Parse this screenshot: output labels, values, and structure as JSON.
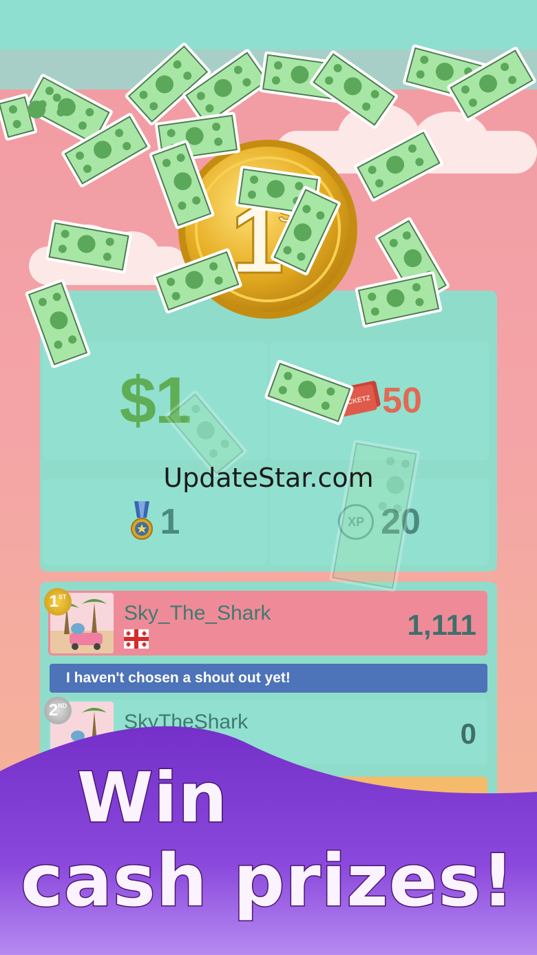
{
  "colors": {
    "money_green": "#5fae56",
    "panel_teal": "#90dccb",
    "accent_purple": "#7a35c8",
    "coin_gold": "#e8b22a"
  },
  "reward": {
    "place": "1",
    "place_suffix": "ST",
    "cash": "$1",
    "tickets": "50",
    "ticket_icon_label": "TICKETZ",
    "medals": "1",
    "xp_label": "XP",
    "xp": "20"
  },
  "leaderboard": [
    {
      "rank": "1",
      "rank_suffix": "ST",
      "name": "Sky_The_Shark",
      "score": "1,111",
      "shout": "I haven't chosen a shout out yet!"
    },
    {
      "rank": "2",
      "rank_suffix": "ND",
      "name": "SkyTheShark",
      "score": "0"
    }
  ],
  "watermark": "UpdateStar.com",
  "promo": {
    "line1": "Win",
    "line2": "cash prizes!"
  },
  "icons": [
    "coin-icon",
    "ticket-icon",
    "medal-icon",
    "xp-icon",
    "flag-icon",
    "dollar-bill-icon"
  ]
}
